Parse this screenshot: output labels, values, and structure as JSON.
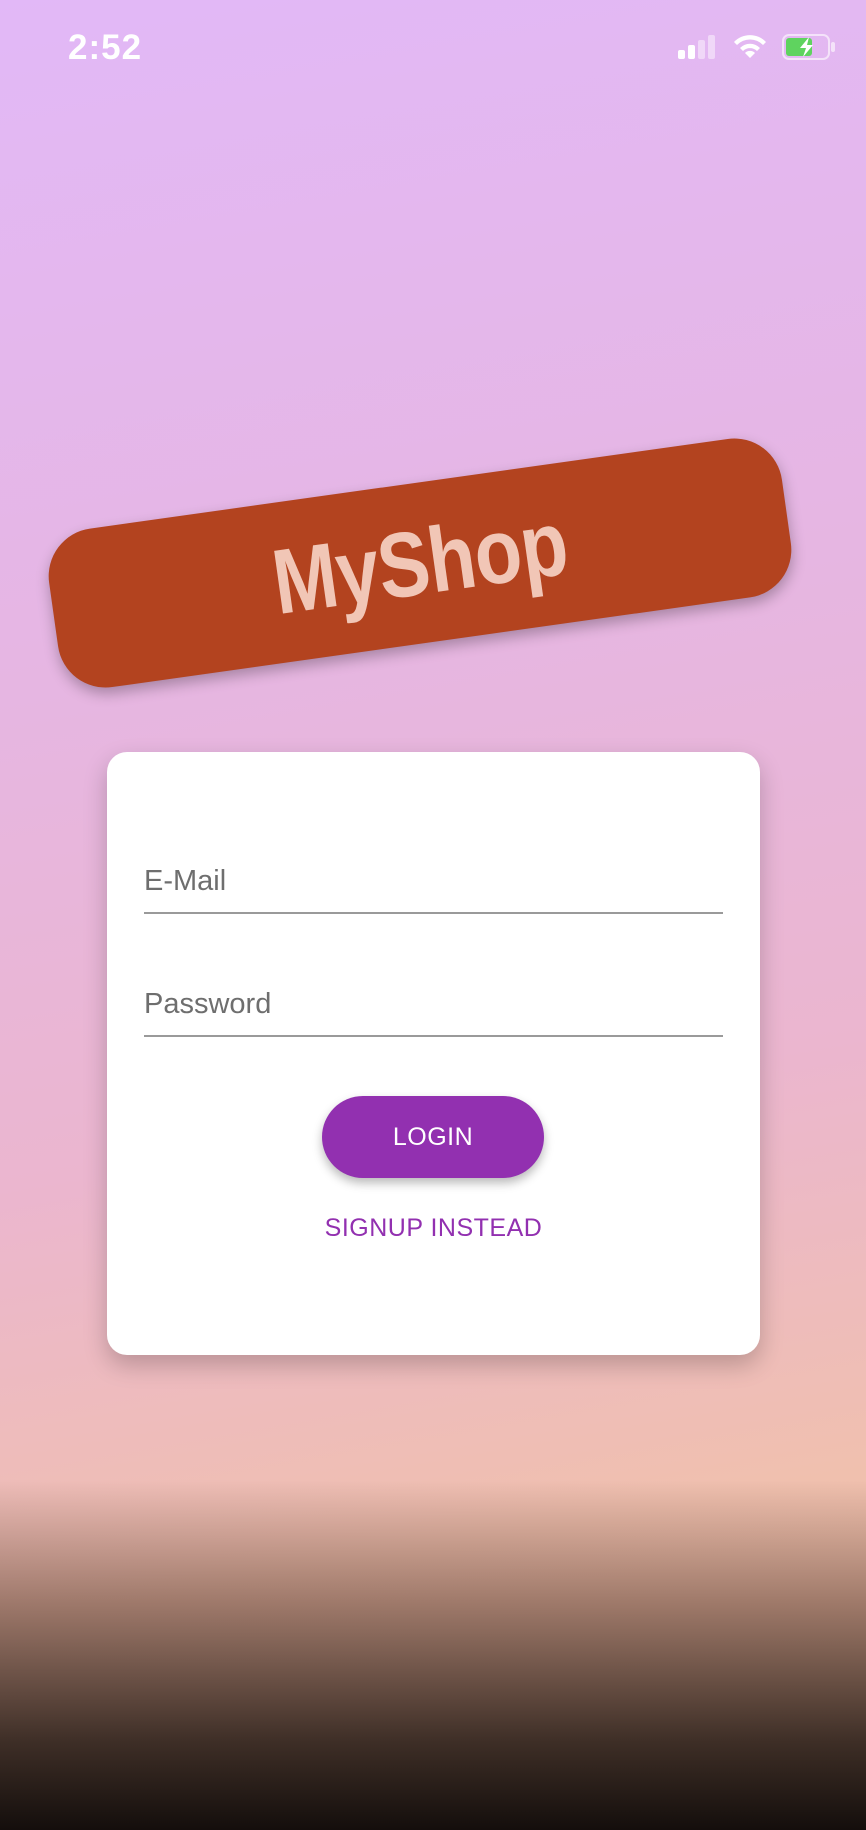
{
  "status_bar": {
    "time": "2:52",
    "icons": [
      "signal-icon",
      "wifi-icon",
      "battery-charging-icon"
    ]
  },
  "logo": {
    "text": "MyShop"
  },
  "auth_form": {
    "email_placeholder": "E-Mail",
    "email_value": "",
    "password_placeholder": "Password",
    "password_value": "",
    "login_label": "LOGIN",
    "signup_label": "SIGNUP INSTEAD"
  },
  "colors": {
    "accent": "#9230b0",
    "logo_banner": "#b3431f",
    "logo_text": "#f1c6b6",
    "gradient_top": "#e2b8f7",
    "gradient_bottom": "#f2c3a8"
  }
}
